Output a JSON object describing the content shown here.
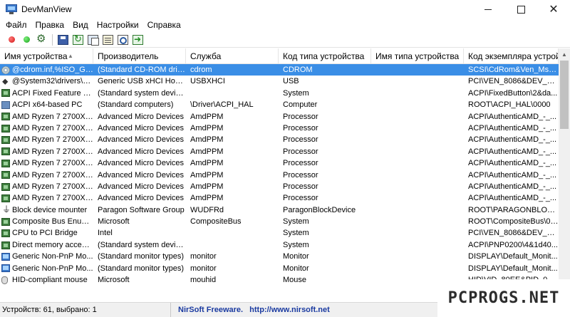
{
  "window": {
    "title": "DevManView",
    "minimize_label": "",
    "maximize_label": "",
    "close_label": "✕"
  },
  "menu": {
    "items": [
      "Файл",
      "Правка",
      "Вид",
      "Настройки",
      "Справка"
    ]
  },
  "toolbar": {
    "buttons": [
      "disable-device",
      "enable-device",
      "uninstall-device",
      "save",
      "refresh",
      "copy",
      "properties",
      "find",
      "exit"
    ]
  },
  "table": {
    "columns": [
      "Имя устройства",
      "Производитель",
      "Служба",
      "Код типа устройства",
      "Имя типа устройства",
      "Код экземпляра устрой..."
    ],
    "sort_indicator": "▲",
    "rows": [
      {
        "icon": "disc-icon",
        "name": "@cdrom.inf,%ISO_Ge...",
        "manufacturer": "(Standard CD-ROM driv...",
        "service": "cdrom",
        "type_code": "CDROM",
        "type_name": "",
        "instance": "SCSI\\CdRom&Ven_Msft...",
        "selected": true
      },
      {
        "icon": "usb-icon",
        "name": "@System32\\drivers\\u...",
        "manufacturer": "Generic USB xHCI Host ...",
        "service": "USBXHCI",
        "type_code": "USB",
        "type_name": "",
        "instance": "PCI\\VEN_8086&DEV_1E3..."
      },
      {
        "icon": "chip-icon",
        "name": "ACPI Fixed Feature Bu...",
        "manufacturer": "(Standard system devices)",
        "service": "",
        "type_code": "System",
        "type_name": "",
        "instance": "ACPI\\FixedButton\\2&da..."
      },
      {
        "icon": "pc-icon",
        "name": "ACPI x64-based PC",
        "manufacturer": "(Standard computers)",
        "service": "\\Driver\\ACPI_HAL",
        "type_code": "Computer",
        "type_name": "",
        "instance": "ROOT\\ACPI_HAL\\0000"
      },
      {
        "icon": "chip-icon",
        "name": "AMD Ryzen 7 2700X Ei...",
        "manufacturer": "Advanced Micro Devices",
        "service": "AmdPPM",
        "type_code": "Processor",
        "type_name": "",
        "instance": "ACPI\\AuthenticAMD_-_..."
      },
      {
        "icon": "chip-icon",
        "name": "AMD Ryzen 7 2700X Ei...",
        "manufacturer": "Advanced Micro Devices",
        "service": "AmdPPM",
        "type_code": "Processor",
        "type_name": "",
        "instance": "ACPI\\AuthenticAMD_-_..."
      },
      {
        "icon": "chip-icon",
        "name": "AMD Ryzen 7 2700X Ei...",
        "manufacturer": "Advanced Micro Devices",
        "service": "AmdPPM",
        "type_code": "Processor",
        "type_name": "",
        "instance": "ACPI\\AuthenticAMD_-_..."
      },
      {
        "icon": "chip-icon",
        "name": "AMD Ryzen 7 2700X Ei...",
        "manufacturer": "Advanced Micro Devices",
        "service": "AmdPPM",
        "type_code": "Processor",
        "type_name": "",
        "instance": "ACPI\\AuthenticAMD_-_..."
      },
      {
        "icon": "chip-icon",
        "name": "AMD Ryzen 7 2700X Ei...",
        "manufacturer": "Advanced Micro Devices",
        "service": "AmdPPM",
        "type_code": "Processor",
        "type_name": "",
        "instance": "ACPI\\AuthenticAMD_-_..."
      },
      {
        "icon": "chip-icon",
        "name": "AMD Ryzen 7 2700X Ei...",
        "manufacturer": "Advanced Micro Devices",
        "service": "AmdPPM",
        "type_code": "Processor",
        "type_name": "",
        "instance": "ACPI\\AuthenticAMD_-_..."
      },
      {
        "icon": "chip-icon",
        "name": "AMD Ryzen 7 2700X Ei...",
        "manufacturer": "Advanced Micro Devices",
        "service": "AmdPPM",
        "type_code": "Processor",
        "type_name": "",
        "instance": "ACPI\\AuthenticAMD_-_..."
      },
      {
        "icon": "chip-icon",
        "name": "AMD Ryzen 7 2700X Ei...",
        "manufacturer": "Advanced Micro Devices",
        "service": "AmdPPM",
        "type_code": "Processor",
        "type_name": "",
        "instance": "ACPI\\AuthenticAMD_-_..."
      },
      {
        "icon": "plug-icon",
        "name": "Block device mounter",
        "manufacturer": "Paragon Software Group",
        "service": "WUDFRd",
        "type_code": "ParagonBlockDevice",
        "type_name": "",
        "instance": "ROOT\\PARAGONBLOCK..."
      },
      {
        "icon": "chip-icon",
        "name": "Composite Bus Enum...",
        "manufacturer": "Microsoft",
        "service": "CompositeBus",
        "type_code": "System",
        "type_name": "",
        "instance": "ROOT\\CompositeBus\\000..."
      },
      {
        "icon": "chip-icon",
        "name": "CPU to PCI Bridge",
        "manufacturer": "Intel",
        "service": "",
        "type_code": "System",
        "type_name": "",
        "instance": "PCI\\VEN_8086&DEV_123..."
      },
      {
        "icon": "chip-icon",
        "name": "Direct memory access...",
        "manufacturer": "(Standard system devices)",
        "service": "",
        "type_code": "System",
        "type_name": "",
        "instance": "ACPI\\PNP0200\\4&1d40..."
      },
      {
        "icon": "monitor-icon",
        "name": "Generic Non-PnP Mo...",
        "manufacturer": "(Standard monitor types)",
        "service": "monitor",
        "type_code": "Monitor",
        "type_name": "",
        "instance": "DISPLAY\\Default_Monit..."
      },
      {
        "icon": "monitor-icon",
        "name": "Generic Non-PnP Mo...",
        "manufacturer": "(Standard monitor types)",
        "service": "monitor",
        "type_code": "Monitor",
        "type_name": "",
        "instance": "DISPLAY\\Default_Monit..."
      },
      {
        "icon": "mouse-icon",
        "name": "HID-compliant mouse",
        "manufacturer": "Microsoft",
        "service": "mouhid",
        "type_code": "Mouse",
        "type_name": "",
        "instance": "HID\\VID_80EE&PID_0021..."
      }
    ]
  },
  "statusbar": {
    "left": "Устройств: 61, выбрано: 1",
    "nirsoft": "NirSoft Freeware.",
    "url": "http://www.nirsoft.net"
  },
  "watermark": {
    "text": "PCPROGS.NET"
  },
  "colors": {
    "selection": "#3a8ee6",
    "link": "#1a3aa0"
  }
}
